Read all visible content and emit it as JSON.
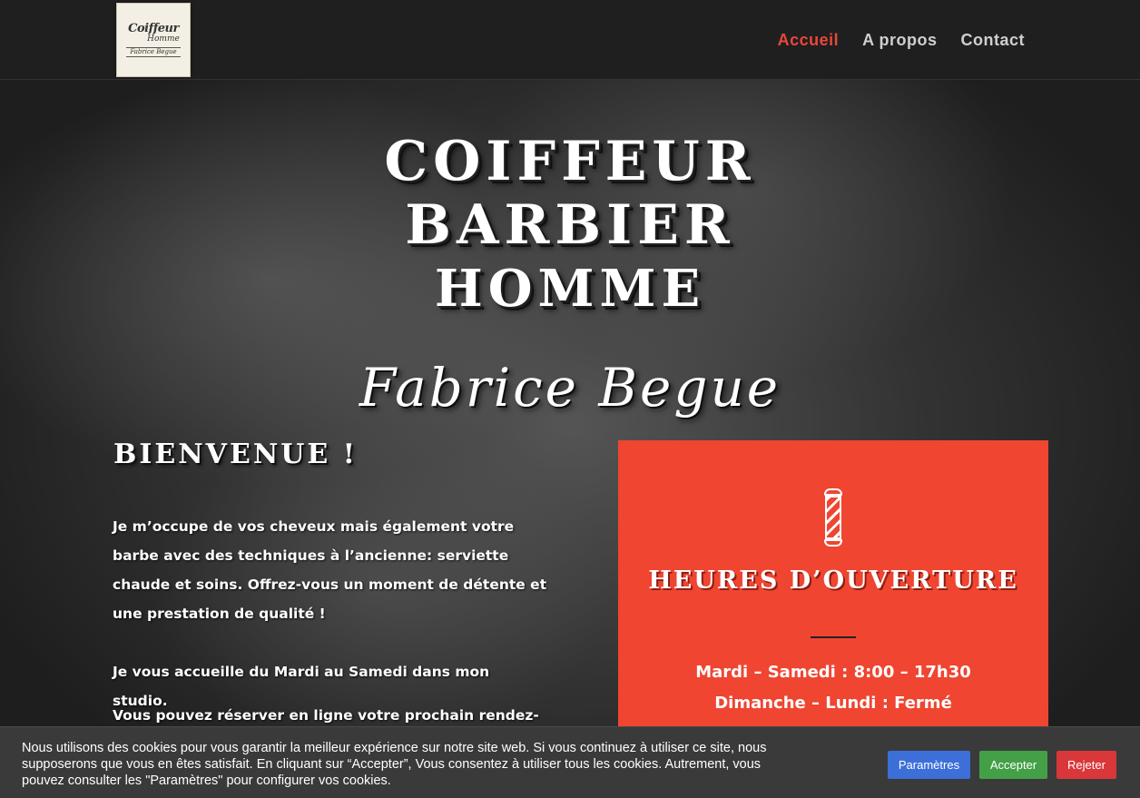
{
  "header": {
    "logo": {
      "line1": "Coiffeur",
      "line2": "Homme",
      "line3": "Fabrice Begue"
    },
    "nav": [
      {
        "label": "Accueil",
        "active": true
      },
      {
        "label": "A propos",
        "active": false
      },
      {
        "label": "Contact",
        "active": false
      }
    ]
  },
  "hero": {
    "title_line1": "COIFFEUR",
    "title_line2": "BARBIER",
    "title_line3": "HOMME",
    "script_name": "Fabrice Begue",
    "welcome": "BIENVENUE !",
    "paragraph1": "Je m’occupe de vos cheveux mais également votre barbe avec des techniques à l’ancienne: serviette chaude et soins. Offrez-vous un moment de détente et une prestation de qualité !",
    "paragraph2": "Je vous accueille du Mardi au Samedi dans mon studio.",
    "paragraph3": "Vous pouvez réserver en ligne votre prochain rendez-vous"
  },
  "hours_card": {
    "icon": "barber-pole-icon",
    "title": "HEURES D’OUVERTURE",
    "line1": "Mardi – Samedi : 8:00 – 17h30",
    "line2": "Dimanche – Lundi : Fermé",
    "color": "#ef4531"
  },
  "cookie": {
    "text": "Nous utilisons des cookies pour vous garantir la meilleur expérience sur notre site web. Si vous continuez à utiliser ce site, nous supposerons que vous en êtes satisfait. En cliquant sur “Accepter”, Vous consentez à utiliser tous les cookies. Autrement, vous pouvez consulter les \"Paramètres\" pour configurer vos cookies.",
    "settings_label": "Paramètres",
    "accept_label": "Accepter",
    "reject_label": "Rejeter"
  }
}
